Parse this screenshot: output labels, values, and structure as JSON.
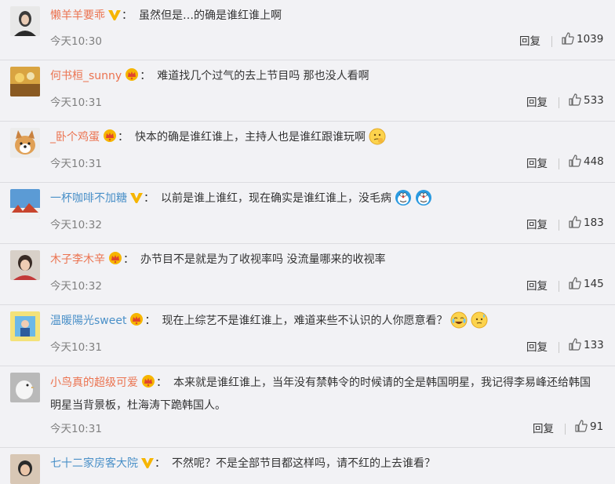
{
  "comments": [
    {
      "name": "懒羊羊要乖",
      "colon": "：",
      "text": "虽然但是…的确是谁红谁上啊",
      "time": "今天10:30",
      "reply": "回复",
      "likes": "1039"
    },
    {
      "name": "何书桓_sunny",
      "colon": "：",
      "text": "难道找几个过气的去上节目吗 那也没人看啊",
      "time": "今天10:31",
      "reply": "回复",
      "likes": "533"
    },
    {
      "name": "_卧个鸡蛋",
      "colon": "：",
      "text": "快本的确是谁红谁上，主持人也是谁红跟谁玩啊",
      "time": "今天10:31",
      "reply": "回复",
      "likes": "448"
    },
    {
      "name": "一杯咖啡不加糖",
      "colon": "：",
      "text": "以前是谁上谁红，现在确实是谁红谁上，没毛病",
      "time": "今天10:32",
      "reply": "回复",
      "likes": "183"
    },
    {
      "name": "木子李木辛",
      "colon": "：",
      "text": "办节目不是就是为了收视率吗 没流量哪来的收视率",
      "time": "今天10:32",
      "reply": "回复",
      "likes": "145"
    },
    {
      "name": "温暖陽光sweet",
      "colon": "：",
      "text": "现在上综艺不是谁红谁上，难道来些不认识的人你愿意看？",
      "time": "今天10:31",
      "reply": "回复",
      "likes": "133"
    },
    {
      "name": "小鸟真的超级可爱",
      "colon": "：",
      "text": "本来就是谁红谁上，当年没有禁韩令的时候请的全是韩国明星，我记得李易峰还给韩国明星当背景板，杜海涛下跪韩国人。",
      "time": "今天10:31",
      "reply": "回复",
      "likes": "91"
    },
    {
      "name": "七十二家房客大院",
      "colon": "：",
      "text": "不然呢？不是全部节目都这样吗，请不红的上去谁看？",
      "time": "",
      "reply": "",
      "likes": ""
    }
  ],
  "colors": {
    "name": "#eb7350",
    "name_blue": "#4a90c8",
    "vip_gold": "#f6b500",
    "time": "#808080"
  }
}
